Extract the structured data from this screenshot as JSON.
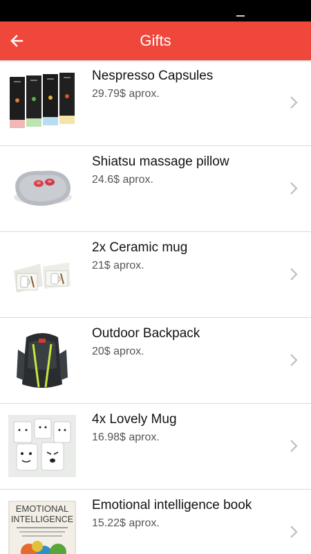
{
  "app": {
    "title": "Gifts",
    "accent_color": "#f0473c"
  },
  "gifts": [
    {
      "name": "Nespresso Capsules",
      "price": "29.79$ aprox.",
      "image": "nespresso-capsules-image"
    },
    {
      "name": "Shiatsu massage pillow",
      "price": "24.6$ aprox.",
      "image": "massage-pillow-image"
    },
    {
      "name": "2x Ceramic mug",
      "price": "21$ aprox.",
      "image": "ceramic-mug-image"
    },
    {
      "name": "Outdoor Backpack",
      "price": "20$ aprox.",
      "image": "backpack-image"
    },
    {
      "name": "4x Lovely Mug",
      "price": "16.98$ aprox.",
      "image": "lovely-mug-image"
    },
    {
      "name": "Emotional intelligence book",
      "price": "15.22$ aprox.",
      "image": "book-cover-image",
      "cover_text": [
        "EMOTIONAL",
        "INTELLIGENCE"
      ]
    }
  ]
}
